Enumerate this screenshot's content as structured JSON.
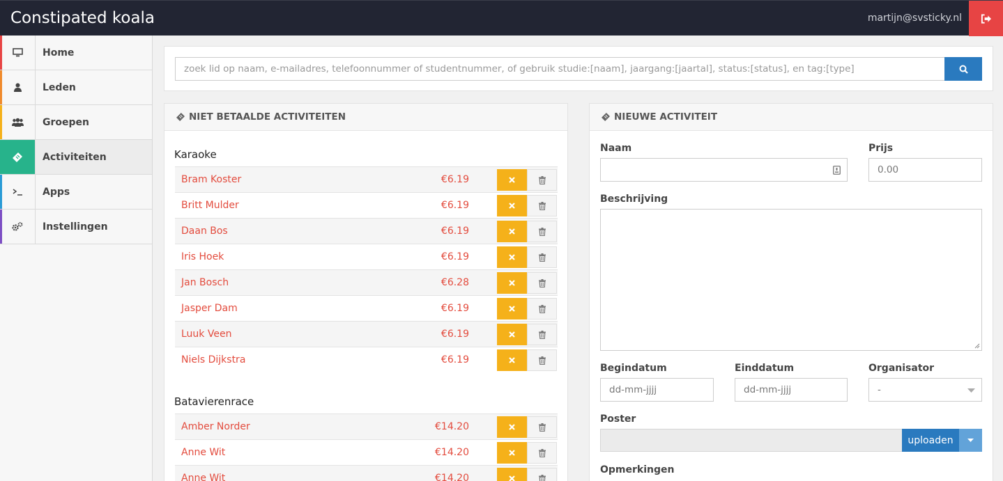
{
  "app": {
    "title": "Constipated koala",
    "user_email": "martijn@svsticky.nl"
  },
  "sidebar": {
    "items": [
      {
        "label": "Home",
        "icon": "desktop-icon",
        "color": "#e74444"
      },
      {
        "label": "Leden",
        "icon": "user-icon",
        "color": "#f08a2c"
      },
      {
        "label": "Groepen",
        "icon": "users-icon",
        "color": "#f5b11a"
      },
      {
        "label": "Activiteiten",
        "icon": "ticket-icon",
        "color": "#27b38b"
      },
      {
        "label": "Apps",
        "icon": "terminal-icon",
        "color": "#2a9bd6"
      },
      {
        "label": "Instellingen",
        "icon": "cogs-icon",
        "color": "#7d4fc4"
      }
    ],
    "active_index": 3
  },
  "search": {
    "placeholder": "zoek lid op naam, e-mailadres, telefoonnummer of studentnummer, of gebruik studie:[naam], jaargang:[jaartal], status:[status], en tag:[type]"
  },
  "unpaid": {
    "title": "NIET BETAALDE ACTIVITEITEN",
    "groups": [
      {
        "name": "Karaoke",
        "rows": [
          {
            "name": "Bram Koster",
            "price": "€6.19"
          },
          {
            "name": "Britt Mulder",
            "price": "€6.19"
          },
          {
            "name": "Daan Bos",
            "price": "€6.19"
          },
          {
            "name": "Iris Hoek",
            "price": "€6.19"
          },
          {
            "name": "Jan Bosch",
            "price": "€6.28"
          },
          {
            "name": "Jasper Dam",
            "price": "€6.19"
          },
          {
            "name": "Luuk Veen",
            "price": "€6.19"
          },
          {
            "name": "Niels Dijkstra",
            "price": "€6.19"
          }
        ]
      },
      {
        "name": "Batavierenrace",
        "rows": [
          {
            "name": "Amber Norder",
            "price": "€14.20"
          },
          {
            "name": "Anne Wit",
            "price": "€14.20"
          },
          {
            "name": "Anne Wit",
            "price": "€14.20"
          }
        ]
      }
    ]
  },
  "new_activity": {
    "title": "NIEUWE ACTIVITEIT",
    "labels": {
      "naam": "Naam",
      "prijs": "Prijs",
      "beschrijving": "Beschrijving",
      "begindatum": "Begindatum",
      "einddatum": "Einddatum",
      "organisator": "Organisator",
      "poster": "Poster",
      "opmerkingen": "Opmerkingen"
    },
    "prijs_value": "0.00",
    "begindatum_placeholder": "dd-mm-jjjj",
    "einddatum_placeholder": "dd-mm-jjjj",
    "organisator_value": "-",
    "upload_label": "uploaden"
  },
  "colors": {
    "accent": "#2a7abf",
    "danger": "#e74444",
    "warning": "#f5b11a",
    "active": "#27b38b",
    "link": "#e34b3d"
  }
}
